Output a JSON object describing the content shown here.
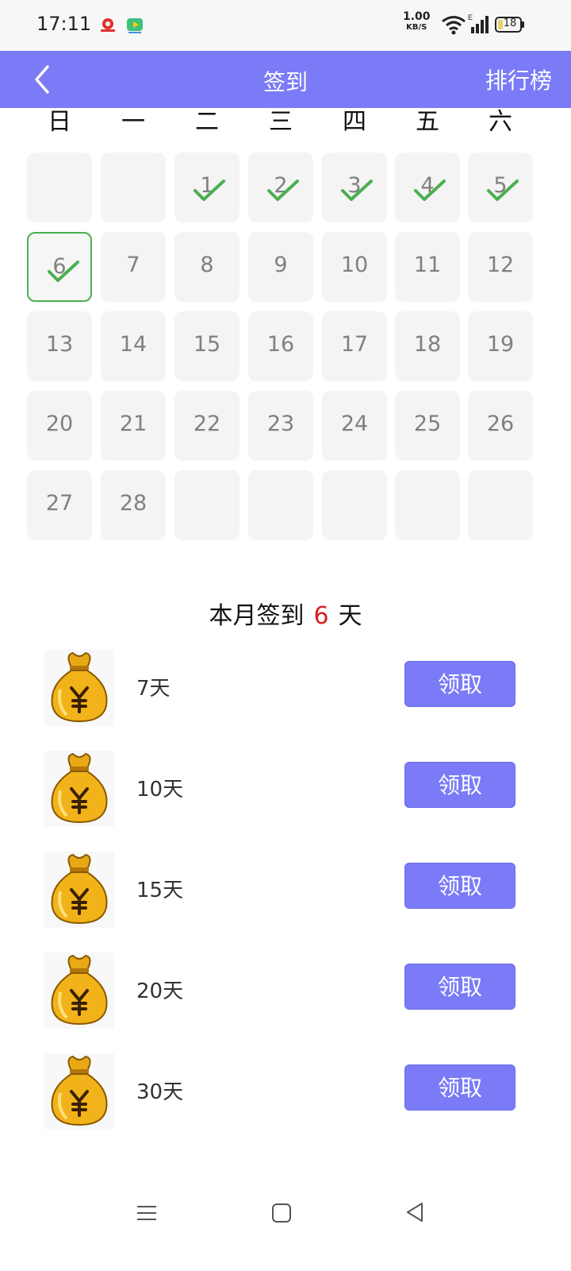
{
  "status_bar": {
    "time": "17:11",
    "net_speed": "1.00",
    "net_unit": "KB/S",
    "battery": "18",
    "icons": [
      "app-icon-red",
      "app-icon-video",
      "wifi-icon",
      "signal-icon",
      "battery-icon"
    ]
  },
  "header": {
    "title": "签到",
    "right_link": "排行榜",
    "back_icon": "chevron-left-icon"
  },
  "weekdays": [
    "日",
    "一",
    "二",
    "三",
    "四",
    "五",
    "六"
  ],
  "calendar": {
    "leading_blanks": 2,
    "days_in_month": 28,
    "trailing_blanks": 5,
    "signed_days": [
      1,
      2,
      3,
      4,
      5,
      6
    ],
    "today": 6,
    "check_color": "#4caf50"
  },
  "summary": {
    "prefix": "本月签到",
    "count": "6",
    "suffix": "天"
  },
  "rewards": [
    {
      "label": "7天",
      "button": "领取",
      "icon": "money-bag-icon"
    },
    {
      "label": "10天",
      "button": "领取",
      "icon": "money-bag-icon"
    },
    {
      "label": "15天",
      "button": "领取",
      "icon": "money-bag-icon"
    },
    {
      "label": "20天",
      "button": "领取",
      "icon": "money-bag-icon"
    },
    {
      "label": "30天",
      "button": "领取",
      "icon": "money-bag-icon"
    }
  ],
  "colors": {
    "accent": "#7b7bf7",
    "highlight": "#d32020",
    "today_border": "#4caf50"
  },
  "nav_bar": {
    "icons": [
      "menu-icon",
      "home-icon",
      "back-triangle-icon"
    ]
  }
}
